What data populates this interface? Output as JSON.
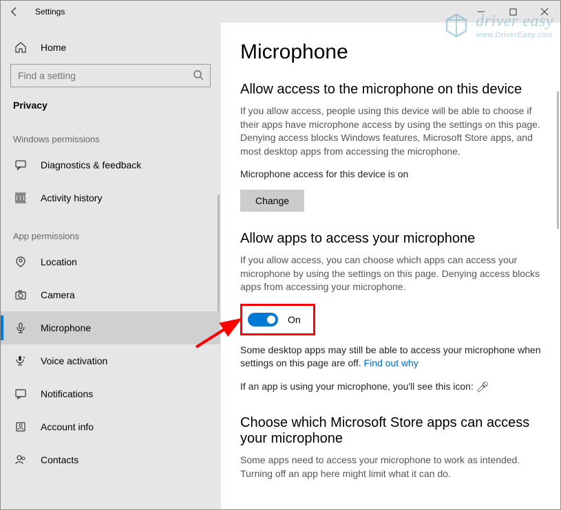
{
  "titlebar": {
    "title": "Settings"
  },
  "sidebar": {
    "home_label": "Home",
    "search_placeholder": "Find a setting",
    "active_section": "Privacy",
    "group1_label": "Windows permissions",
    "group1_items": [
      {
        "label": "Diagnostics & feedback"
      },
      {
        "label": "Activity history"
      }
    ],
    "group2_label": "App permissions",
    "group2_items": [
      {
        "label": "Location"
      },
      {
        "label": "Camera"
      },
      {
        "label": "Microphone"
      },
      {
        "label": "Voice activation"
      },
      {
        "label": "Notifications"
      },
      {
        "label": "Account info"
      },
      {
        "label": "Contacts"
      }
    ]
  },
  "main": {
    "page_title": "Microphone",
    "section1": {
      "heading": "Allow access to the microphone on this device",
      "body": "If you allow access, people using this device will be able to choose if their apps have microphone access by using the settings on this page. Denying access blocks Windows features, Microsoft Store apps, and most desktop apps from accessing the microphone.",
      "status": "Microphone access for this device is on",
      "button": "Change"
    },
    "section2": {
      "heading": "Allow apps to access your microphone",
      "body": "If you allow access, you can choose which apps can access your microphone by using the settings on this page. Denying access blocks apps from accessing your microphone.",
      "toggle_label": "On",
      "note_prefix": "Some desktop apps may still be able to access your microphone when settings on this page are off. ",
      "note_link": "Find out why",
      "usage_note": "If an app is using your microphone, you'll see this icon: "
    },
    "section3": {
      "heading": "Choose which Microsoft Store apps can access your microphone",
      "body": "Some apps need to access your microphone to work as intended. Turning off an app here might limit what it can do."
    }
  },
  "watermark": {
    "title": "driver easy",
    "sub": "www.DriverEasy.com"
  }
}
